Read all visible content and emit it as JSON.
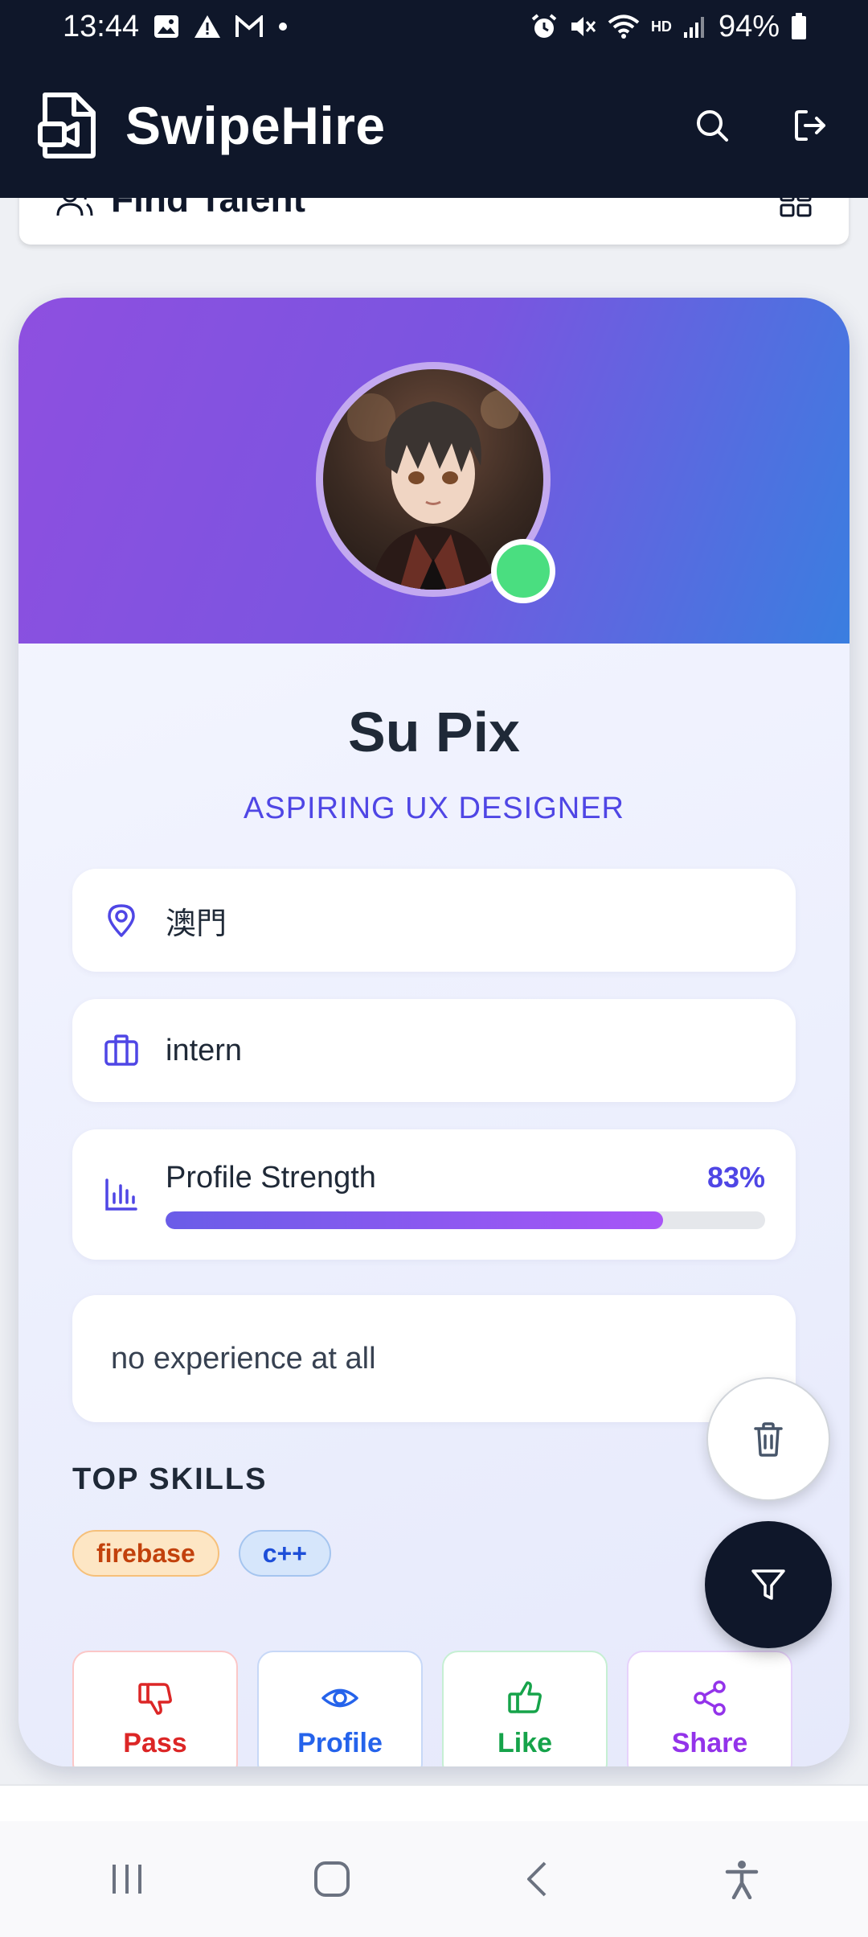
{
  "status_bar": {
    "time": "13:44",
    "battery": "94%",
    "network_badge": "HD",
    "icons_left": [
      "image-icon",
      "alert-icon",
      "gmail-icon",
      "dot-icon"
    ],
    "icons_right": [
      "alarm-icon",
      "mute-icon",
      "wifi-icon",
      "signal-icon",
      "battery-icon"
    ]
  },
  "header": {
    "app_name": "SwipeHire",
    "actions": [
      "search-icon",
      "logout-icon"
    ]
  },
  "find_bar": {
    "title": "Find Talent"
  },
  "profile": {
    "name": "Su Pix",
    "role": "ASPIRING UX DESIGNER",
    "location": "澳門",
    "job_type": "intern",
    "strength_label": "Profile Strength",
    "strength_value": "83%",
    "strength_fraction": 0.83,
    "bio": "no experience at all",
    "online": true
  },
  "skills": {
    "heading": "TOP SKILLS",
    "items": [
      "firebase",
      "c++"
    ]
  },
  "actions": {
    "pass": "Pass",
    "profile": "Profile",
    "like": "Like",
    "share": "Share"
  },
  "colors": {
    "header_bg": "#0f172a",
    "accent": "#4f46e5",
    "banner_start": "#8e4fe0",
    "banner_end": "#3a7ee0",
    "online": "#4ade80"
  }
}
